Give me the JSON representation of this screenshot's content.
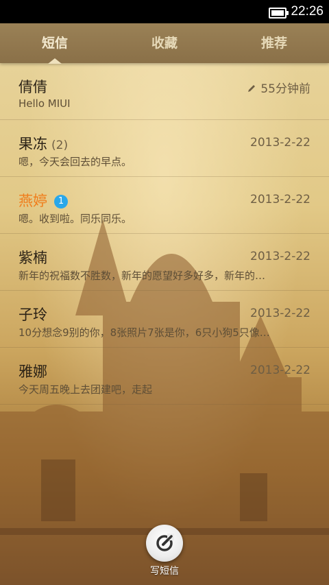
{
  "status_bar": {
    "time": "22:26",
    "battery_icon": "battery-full-icon"
  },
  "tabs": [
    {
      "label": "短信",
      "active": true
    },
    {
      "label": "收藏",
      "active": false
    },
    {
      "label": "推荐",
      "active": false
    }
  ],
  "conversations": [
    {
      "name": "倩倩",
      "date": "55分钟前",
      "preview": "Hello MIUI",
      "draft": true
    },
    {
      "name": "果冻",
      "count": "(2)",
      "date": "2013-2-22",
      "preview": "嗯，今天会回去的早点。"
    },
    {
      "name": "燕婷",
      "badge": "1",
      "date": "2013-2-22",
      "preview": "嗯。收到啦。同乐同乐。",
      "highlight": true
    },
    {
      "name": "紫楠",
      "date": "2013-2-22",
      "preview": "新年的祝福数不胜数，新年的愿望好多好多，新年的…"
    },
    {
      "name": "子玲",
      "date": "2013-2-22",
      "preview": "10分想念9别的你，8张照片7张是你，6只小狗5只像…"
    },
    {
      "name": "雅娜",
      "date": "2013-2-22",
      "preview": "今天周五晚上去团建吧，走起"
    }
  ],
  "compose": {
    "label": "写短信"
  },
  "colors": {
    "highlight": "#f07d1b",
    "badge": "#29a7ea",
    "tabbar": "#8a7048"
  }
}
